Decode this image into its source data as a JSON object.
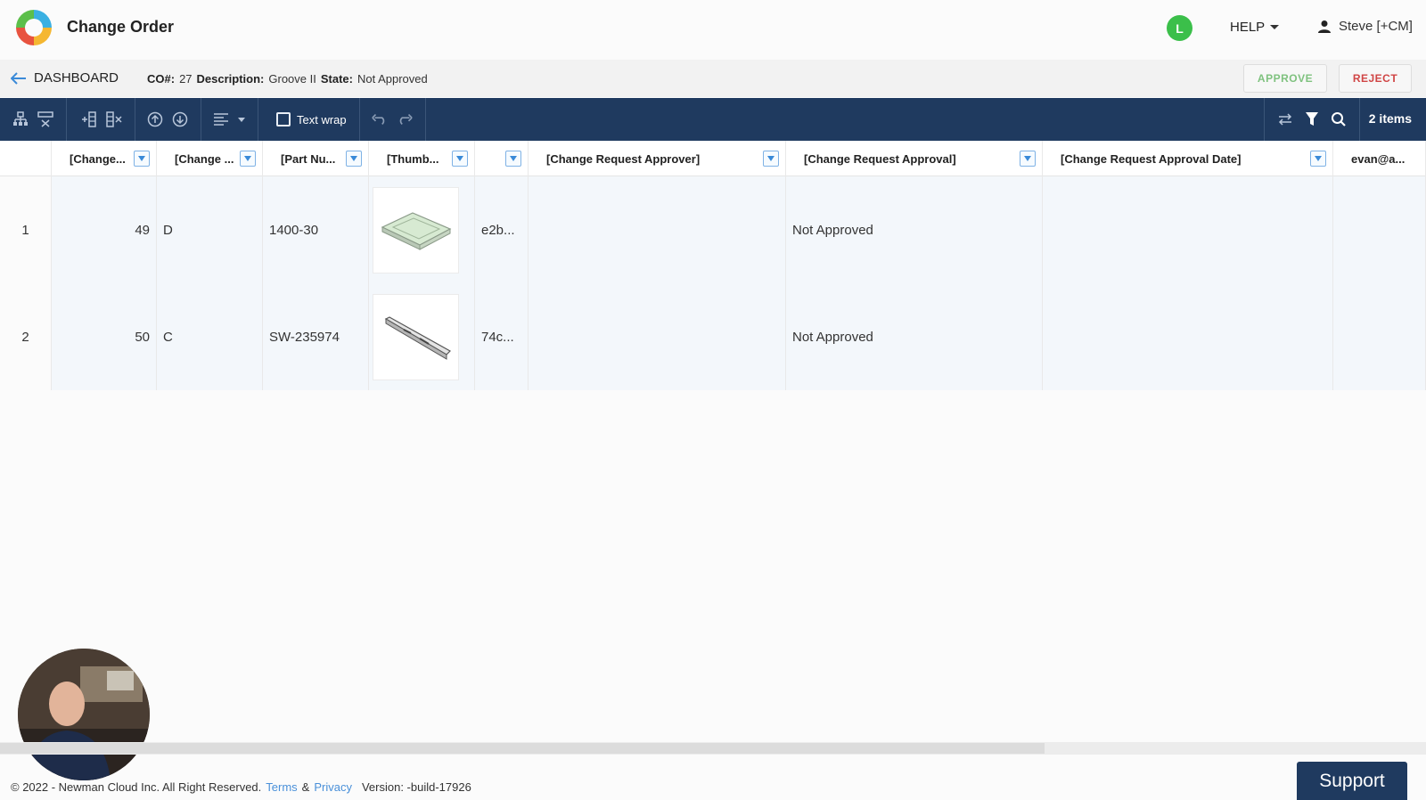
{
  "app": {
    "title": "Change Order"
  },
  "header": {
    "avatar_initial": "L",
    "help_label": "HELP",
    "user_label": "Steve [+CM]"
  },
  "subheader": {
    "back_label": "DASHBOARD",
    "co_label": "CO#:",
    "co_value": "27",
    "description_label": "Description:",
    "description_value": "Groove II",
    "state_label": "State:",
    "state_value": "Not Approved",
    "approve_label": "APPROVE",
    "reject_label": "REJECT"
  },
  "toolbar": {
    "text_wrap_label": "Text wrap",
    "items_count": "2 items"
  },
  "grid": {
    "columns": [
      "",
      "[Change...",
      "[Change ...",
      "[Part Nu...",
      "[Thumb...",
      "",
      "[Change Request Approver]",
      "[Change Request Approval]",
      "[Change Request Approval Date]",
      "evan@a..."
    ],
    "rows": [
      {
        "index": "1",
        "change_num": "49",
        "change_rev": "D",
        "part_number": "1400-30",
        "thumb_icon": "tray-part-thumbnail",
        "hash": "e2b...",
        "approver": "",
        "approval": "Not Approved",
        "approval_date": "",
        "evan": ""
      },
      {
        "index": "2",
        "change_num": "50",
        "change_rev": "C",
        "part_number": "SW-235974",
        "thumb_icon": "bracket-part-thumbnail",
        "hash": "74c...",
        "approver": "",
        "approval": "Not Approved",
        "approval_date": "",
        "evan": ""
      }
    ]
  },
  "footer": {
    "copyright": "© 2022 - Newman Cloud Inc. All Right Reserved.",
    "terms": "Terms",
    "amp": "&",
    "privacy": "Privacy",
    "version": "Version: -build-17926"
  },
  "support_label": "Support",
  "colors": {
    "toolbar_bg": "#1f3a5f",
    "approve": "#7fc27f",
    "reject": "#d04545",
    "avatar": "#3bbf4a",
    "link": "#4a90d9"
  }
}
